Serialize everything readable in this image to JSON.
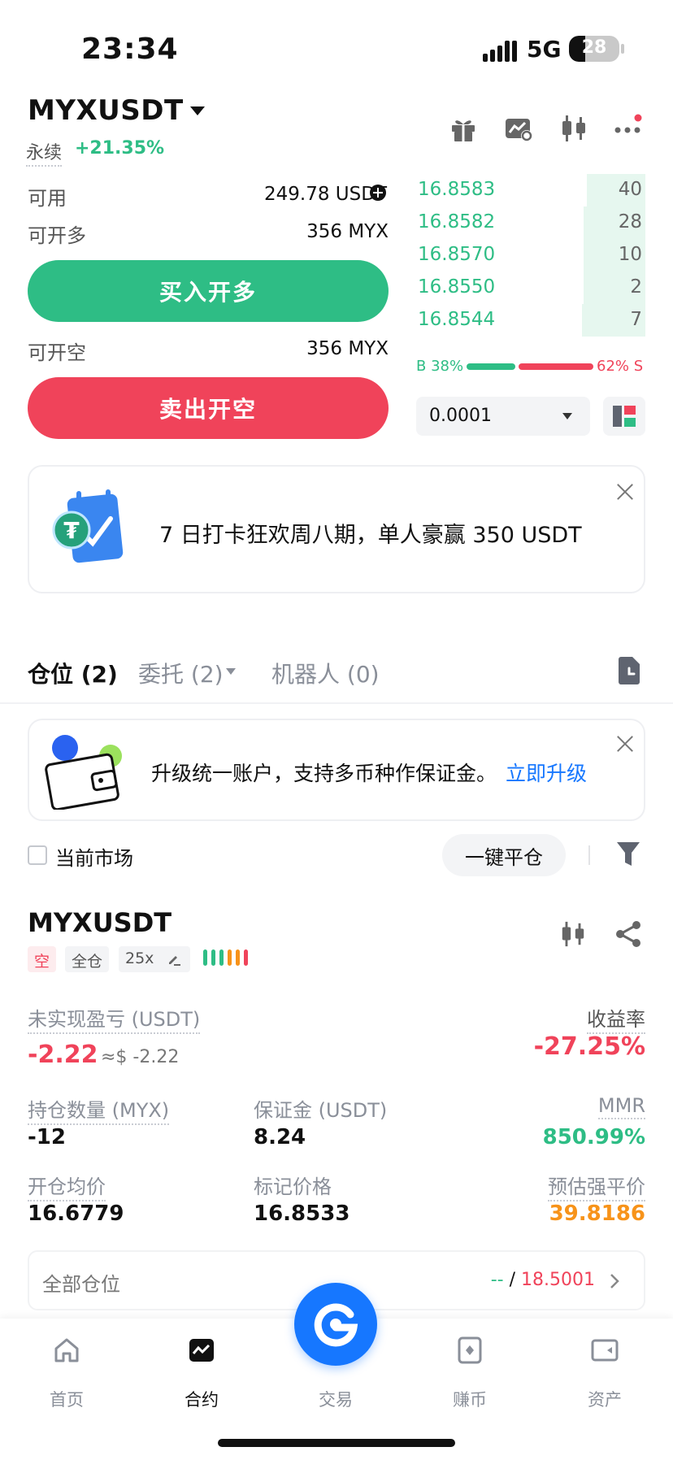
{
  "status_bar": {
    "time": "23:34",
    "network": "5G",
    "battery": "28"
  },
  "header": {
    "symbol": "MYXUSDT",
    "contract_type": "永续",
    "change": "+21.35%"
  },
  "order_form": {
    "available_label": "可用",
    "available_value": "249.78 USDT",
    "can_long_label": "可开多",
    "can_long_value": "356 MYX",
    "buy_label": "买入开多",
    "can_short_label": "可开空",
    "can_short_value": "356 MYX",
    "sell_label": "卖出开空"
  },
  "order_book": {
    "bids": [
      {
        "price": "16.8583",
        "qty": "40"
      },
      {
        "price": "16.8582",
        "qty": "28"
      },
      {
        "price": "16.8570",
        "qty": "10"
      },
      {
        "price": "16.8550",
        "qty": "2"
      },
      {
        "price": "16.8544",
        "qty": "7"
      }
    ],
    "ratio_buy": "B 38%",
    "ratio_sell": "62% S",
    "ratio_buy_fraction": 0.38,
    "precision": "0.0001"
  },
  "promo": {
    "text": "7 日打卡狂欢周八期，单人豪赢 350 USDT"
  },
  "tabs": {
    "positions": "仓位 (2)",
    "orders": "委托 (2)",
    "bots": "机器人 (0)"
  },
  "upgrade": {
    "text": "升级统一账户，支持多币种作保证金。",
    "link": "立即升级"
  },
  "filter": {
    "current_market": "当前市场",
    "close_all": "一键平仓"
  },
  "position": {
    "symbol": "MYXUSDT",
    "side": "空",
    "margin_mode": "全仓",
    "leverage": "25x",
    "unrealized_label": "未实现盈亏 (USDT)",
    "unrealized_value": "-2.22",
    "unrealized_usd": "≈$ -2.22",
    "roe_label": "收益率",
    "roe_value": "-27.25%",
    "size_label": "持仓数量 (MYX)",
    "size_value": "-12",
    "margin_label": "保证金 (USDT)",
    "margin_value": "8.24",
    "mmr_label": "MMR",
    "mmr_value": "850.99%",
    "entry_label": "开仓均价",
    "entry_value": "16.6779",
    "mark_label": "标记价格",
    "mark_value": "16.8533",
    "liq_label": "预估强平价",
    "liq_value": "39.8186"
  },
  "all_positions": {
    "label": "全部仓位",
    "tp": "--",
    "sep": "/",
    "sl": "18.5001"
  },
  "nav": {
    "home": "首页",
    "futures": "合约",
    "trade": "交易",
    "earn": "赚币",
    "assets": "资产"
  },
  "colors": {
    "green": "#2ebd85",
    "red": "#f0435a",
    "orange": "#f7931a",
    "blue": "#1677ff"
  }
}
